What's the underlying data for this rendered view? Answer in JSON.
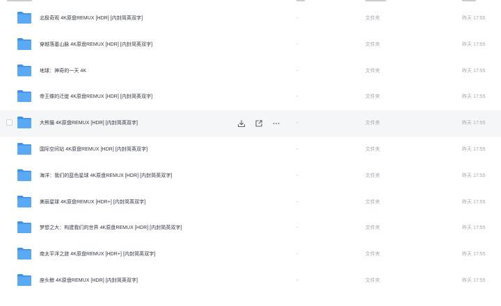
{
  "rows": [
    {
      "name": "北极奇观 4K原盘REMUX [HDR] [内封简英双字]",
      "size": "-",
      "type": "文件夹",
      "mtime": "昨天 17:55"
    },
    {
      "name": "穿越落基山脉 4K原盘REMUX [HDR] [内封简英双字]",
      "size": "-",
      "type": "文件夹",
      "mtime": "昨天 17:55"
    },
    {
      "name": "地球：神奇的一天 4K",
      "size": "-",
      "type": "文件夹",
      "mtime": "昨天 17:55"
    },
    {
      "name": "帝王蝶的迁徙 4K原盘REMUX [HDR] [内封简英双字]",
      "size": "-",
      "type": "文件夹",
      "mtime": "昨天 17:55"
    },
    {
      "name": "大熊猫 4K原盘REMUX [HDR] [内封简英双字]",
      "size": "-",
      "type": "文件夹",
      "mtime": "昨天 17:55"
    },
    {
      "name": "国际空间站 4K原盘REMUX [HDR] [内封简英双字]",
      "size": "-",
      "type": "文件夹",
      "mtime": "昨天 17:55"
    },
    {
      "name": "海洋：我们的蓝色星球 4K原盘REMUX [HDR] [内封简英双字]",
      "size": "-",
      "type": "文件夹",
      "mtime": "昨天 17:55"
    },
    {
      "name": "美丽星球 4K原盘REMUX [HDR+] [内封简英双字]",
      "size": "-",
      "type": "文件夹",
      "mtime": "昨天 17:55"
    },
    {
      "name": "梦想之大：构建我们的世界 4K原盘REMUX [HDR] [内封简英双字]",
      "size": "-",
      "type": "文件夹",
      "mtime": "昨天 17:55"
    },
    {
      "name": "南太平洋之旅 4K原盘REMUX [HDR+] [内封简英双字]",
      "size": "-",
      "type": "文件夹",
      "mtime": "昨天 17:55"
    },
    {
      "name": "座头鲸 4K原盘REMUX [HDR] [内封简英双字]",
      "size": "-",
      "type": "文件夹",
      "mtime": "昨天 17:55"
    }
  ],
  "hover_row_index": 4,
  "icons": {
    "folder": "folder-icon",
    "download": "download-icon",
    "share": "share-icon",
    "more": "more-icon"
  },
  "colors": {
    "folder_body": "#5aa9f5",
    "folder_tab": "#3f90e8",
    "hover_bg": "#f5f6f8",
    "text_primary": "#2f3540",
    "text_secondary": "#a2a7b0"
  }
}
